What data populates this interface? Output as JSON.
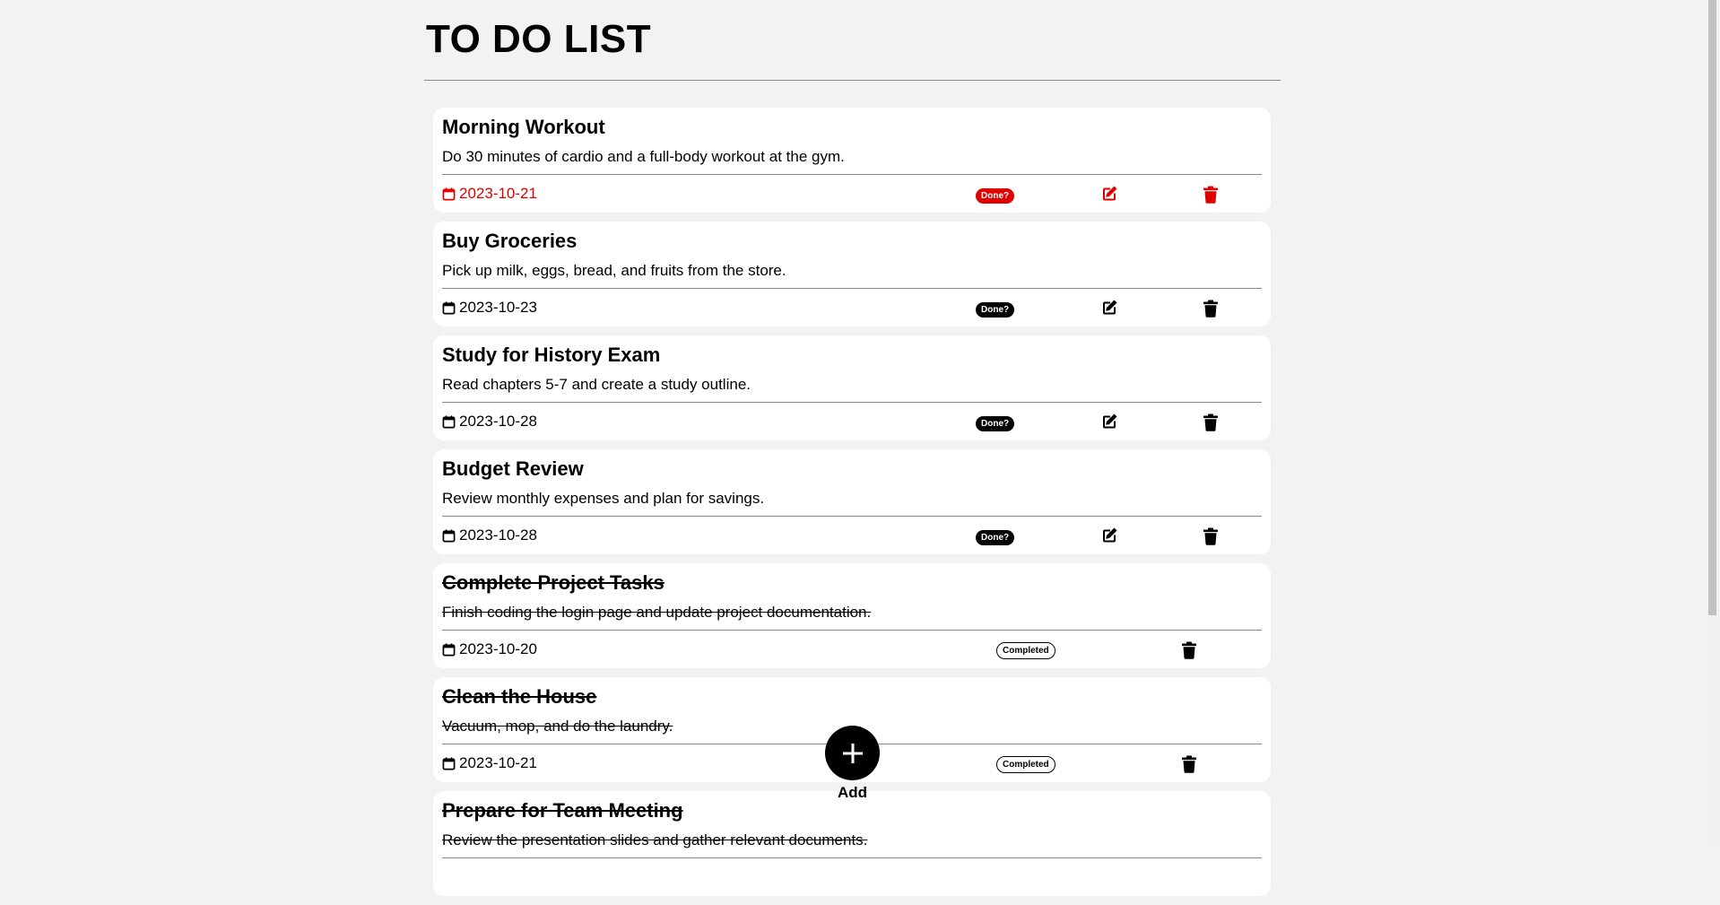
{
  "header": {
    "title": "TO DO LIST"
  },
  "tasks": [
    {
      "title": "Morning Workout",
      "description": "Do 30 minutes of cardio and a full-body workout at the gym.",
      "date": "2023-10-21",
      "status": "pending",
      "overdue": true,
      "badge": "Done?"
    },
    {
      "title": "Buy Groceries",
      "description": "Pick up milk, eggs, bread, and fruits from the store.",
      "date": "2023-10-23",
      "status": "pending",
      "overdue": false,
      "badge": "Done?"
    },
    {
      "title": "Study for History Exam",
      "description": "Read chapters 5-7 and create a study outline.",
      "date": "2023-10-28",
      "status": "pending",
      "overdue": false,
      "badge": "Done?"
    },
    {
      "title": "Budget Review",
      "description": "Review monthly expenses and plan for savings.",
      "date": "2023-10-28",
      "status": "pending",
      "overdue": false,
      "badge": "Done?"
    },
    {
      "title": "Complete Project Tasks",
      "description": "Finish coding the login page and update project documentation.",
      "date": "2023-10-20",
      "status": "completed",
      "overdue": false,
      "badge": "Completed"
    },
    {
      "title": "Clean the House",
      "description": "Vacuum, mop, and do the laundry.",
      "date": "2023-10-21",
      "status": "completed",
      "overdue": false,
      "badge": "Completed"
    },
    {
      "title": "Prepare for Team Meeting",
      "description": "Review the presentation slides and gather relevant documents.",
      "date": "",
      "status": "completed",
      "overdue": false,
      "badge": ""
    }
  ],
  "add_button": {
    "label": "Add",
    "icon": "plus-icon"
  },
  "icons": {
    "date": "calendar-icon",
    "edit": "edit-icon",
    "delete": "trash-icon"
  },
  "colors": {
    "overdue": "#e00000",
    "background": "#f2f2f2",
    "card": "#ffffff",
    "primary": "#000000"
  }
}
